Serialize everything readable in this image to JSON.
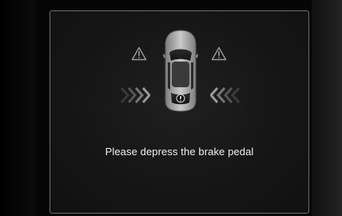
{
  "display": {
    "message": "Please depress the brake pedal"
  },
  "icons": {
    "left_warning": "warning-triangle-icon",
    "right_warning": "warning-triangle-icon",
    "left_arrows": "approach-chevrons-right-icon",
    "right_arrows": "approach-chevrons-left-icon",
    "vehicle": "vehicle-top-view-icon",
    "vehicle_alert": "exclamation-circle-icon"
  },
  "colors": {
    "background": "#000000",
    "panel_border": "#6e6e6e",
    "text": "#f0f0f0",
    "icon_gray": "#9a9a9a"
  }
}
